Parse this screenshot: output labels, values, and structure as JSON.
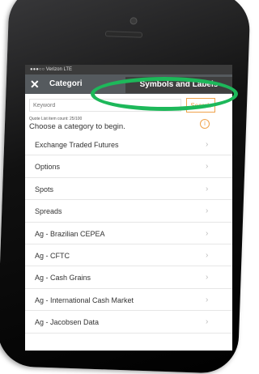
{
  "status": {
    "carrier": "●●●○○ Verizon  LTE"
  },
  "nav": {
    "title": "Categori",
    "close": "✕",
    "button_label": "Symbols and Labels"
  },
  "search": {
    "placeholder": "Keyword",
    "button_label": "Search"
  },
  "quote_count": "Quote List item count: 25/100",
  "prompt": "Choose a category to begin.",
  "info_icon": "i",
  "categories": [
    {
      "label": "Exchange Traded Futures"
    },
    {
      "label": "Options"
    },
    {
      "label": "Spots"
    },
    {
      "label": "Spreads"
    },
    {
      "label": "Ag - Brazilian CEPEA"
    },
    {
      "label": "Ag - CFTC"
    },
    {
      "label": "Ag - Cash Grains"
    },
    {
      "label": "Ag - International Cash Market"
    },
    {
      "label": "Ag - Jacobsen Data"
    }
  ],
  "chevron": "›",
  "colors": {
    "highlight_oval": "#1db85a",
    "accent": "#f0a24a",
    "navbar": "#555a5e"
  }
}
